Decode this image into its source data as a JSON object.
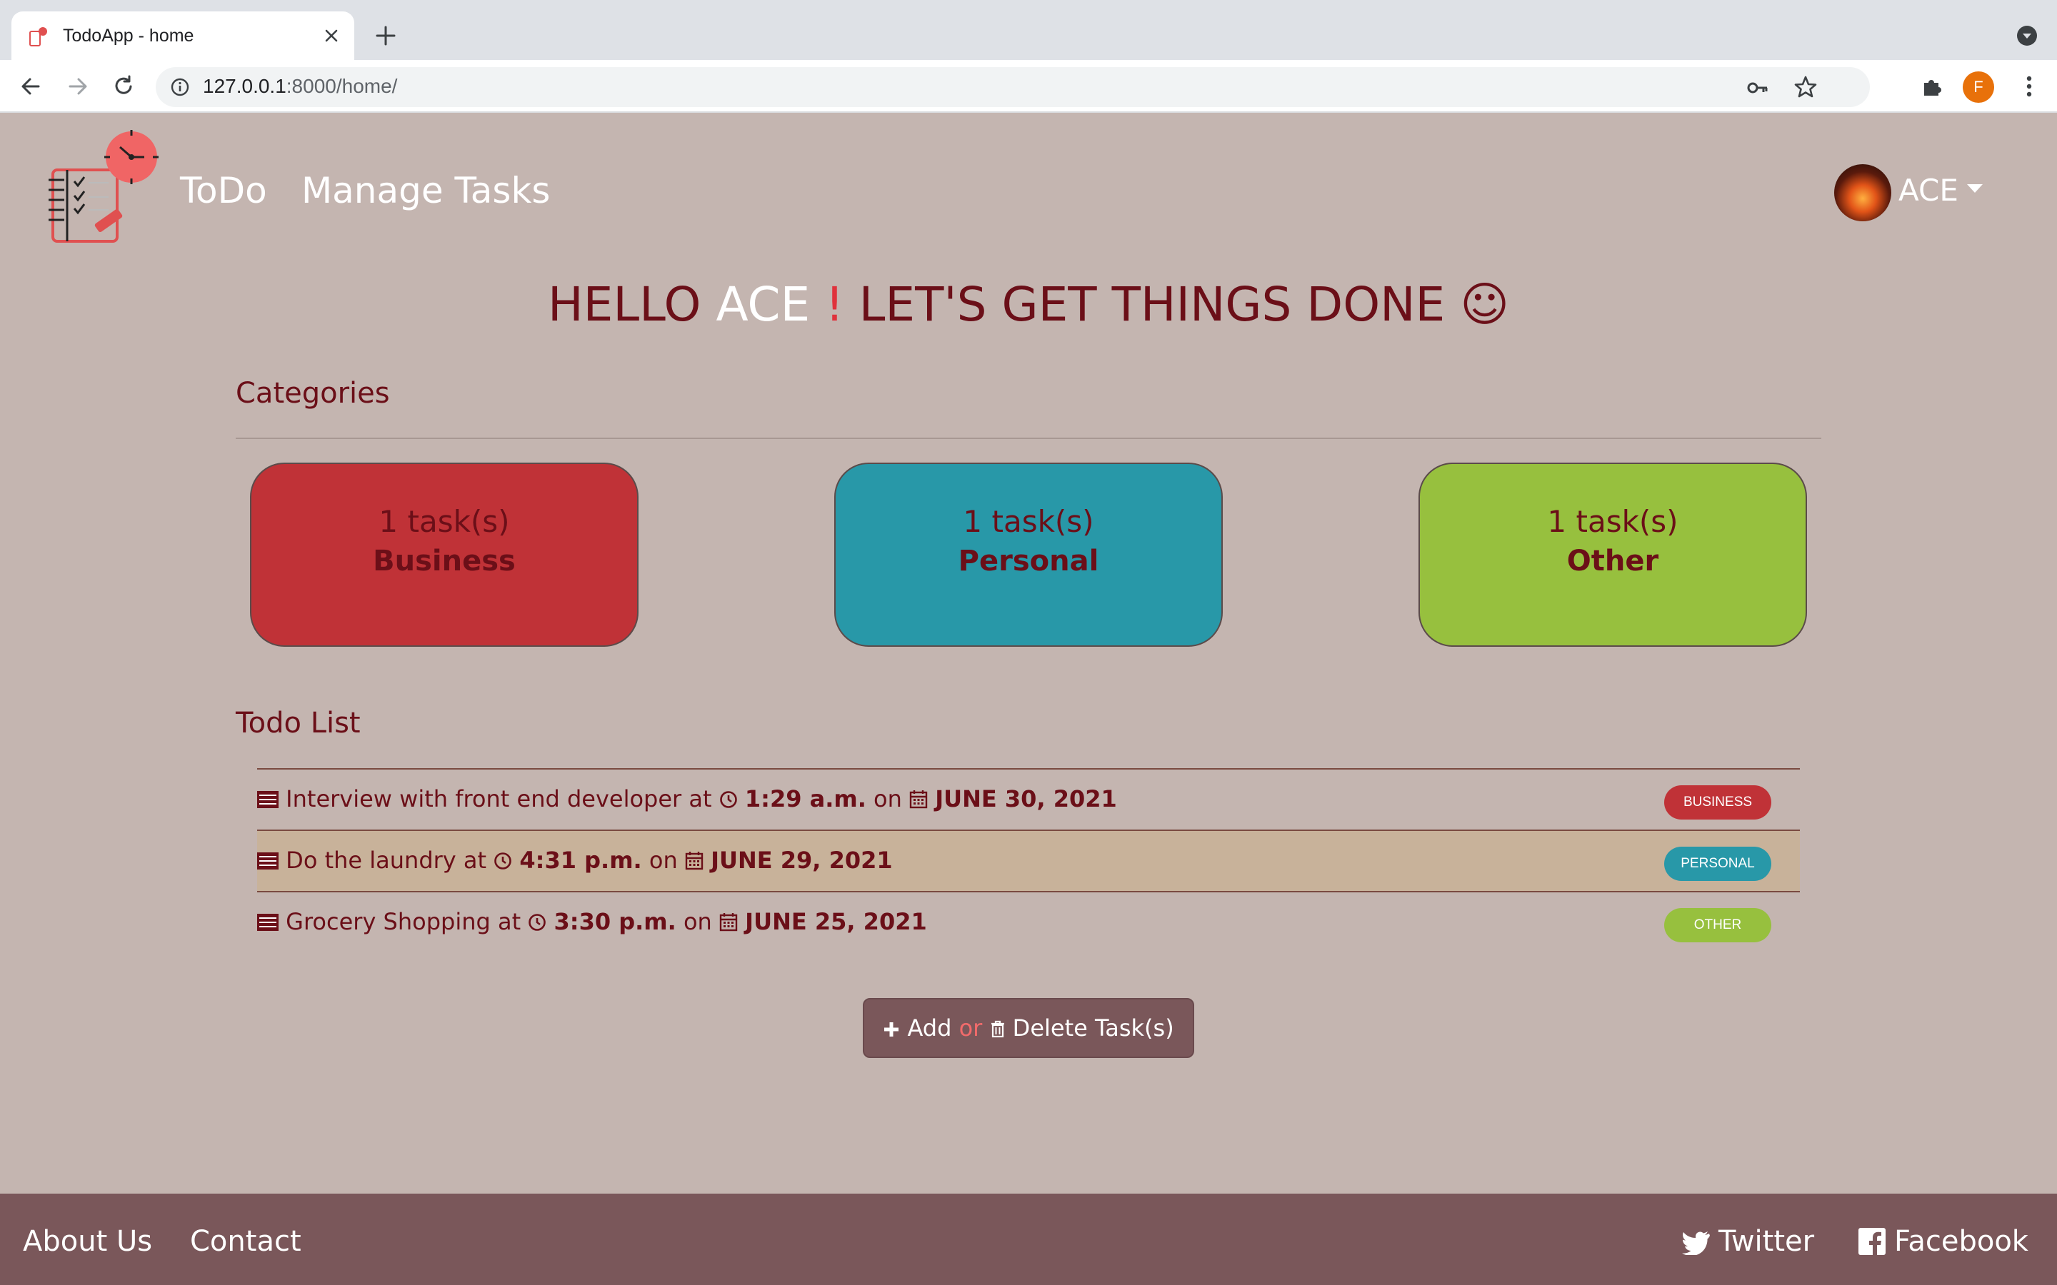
{
  "browser": {
    "tab_title": "TodoApp - home",
    "url_host": "127.0.0.1",
    "url_rest": ":8000/home/",
    "profile_initial": "F"
  },
  "nav": {
    "brand": "ToDo",
    "manage_tasks": "Manage Tasks",
    "user_name": "ACE"
  },
  "greeting": {
    "hello": "HELLO ",
    "name": "ACE",
    "bang": " ! ",
    "rest": "LET'S GET THINGS DONE ☺"
  },
  "categories": {
    "title": "Categories",
    "items": [
      {
        "count": "1 task(s)",
        "name": "Business",
        "color": "#c03237"
      },
      {
        "count": "1 task(s)",
        "name": "Personal",
        "color": "#2898a8"
      },
      {
        "count": "1 task(s)",
        "name": "Other",
        "color": "#97c03e"
      }
    ]
  },
  "todos": {
    "title": "Todo List",
    "at": "at",
    "on": "on",
    "items": [
      {
        "task": "Interview with front end developer",
        "time": "1:29 a.m.",
        "date": "JUNE 30, 2021",
        "badge": "BUSINESS",
        "badge_color": "#c03237"
      },
      {
        "task": "Do the laundry",
        "time": "4:31 p.m.",
        "date": "JUNE 29, 2021",
        "badge": "PERSONAL",
        "badge_color": "#2898a8"
      },
      {
        "task": "Grocery Shopping",
        "time": "3:30 p.m.",
        "date": "JUNE 25, 2021",
        "badge": "OTHER",
        "badge_color": "#97c03e"
      }
    ]
  },
  "action": {
    "add": "Add",
    "or": "or",
    "delete": "Delete Task(s)"
  },
  "footer": {
    "about": "About Us",
    "contact": "Contact",
    "twitter": "Twitter",
    "facebook": "Facebook"
  }
}
